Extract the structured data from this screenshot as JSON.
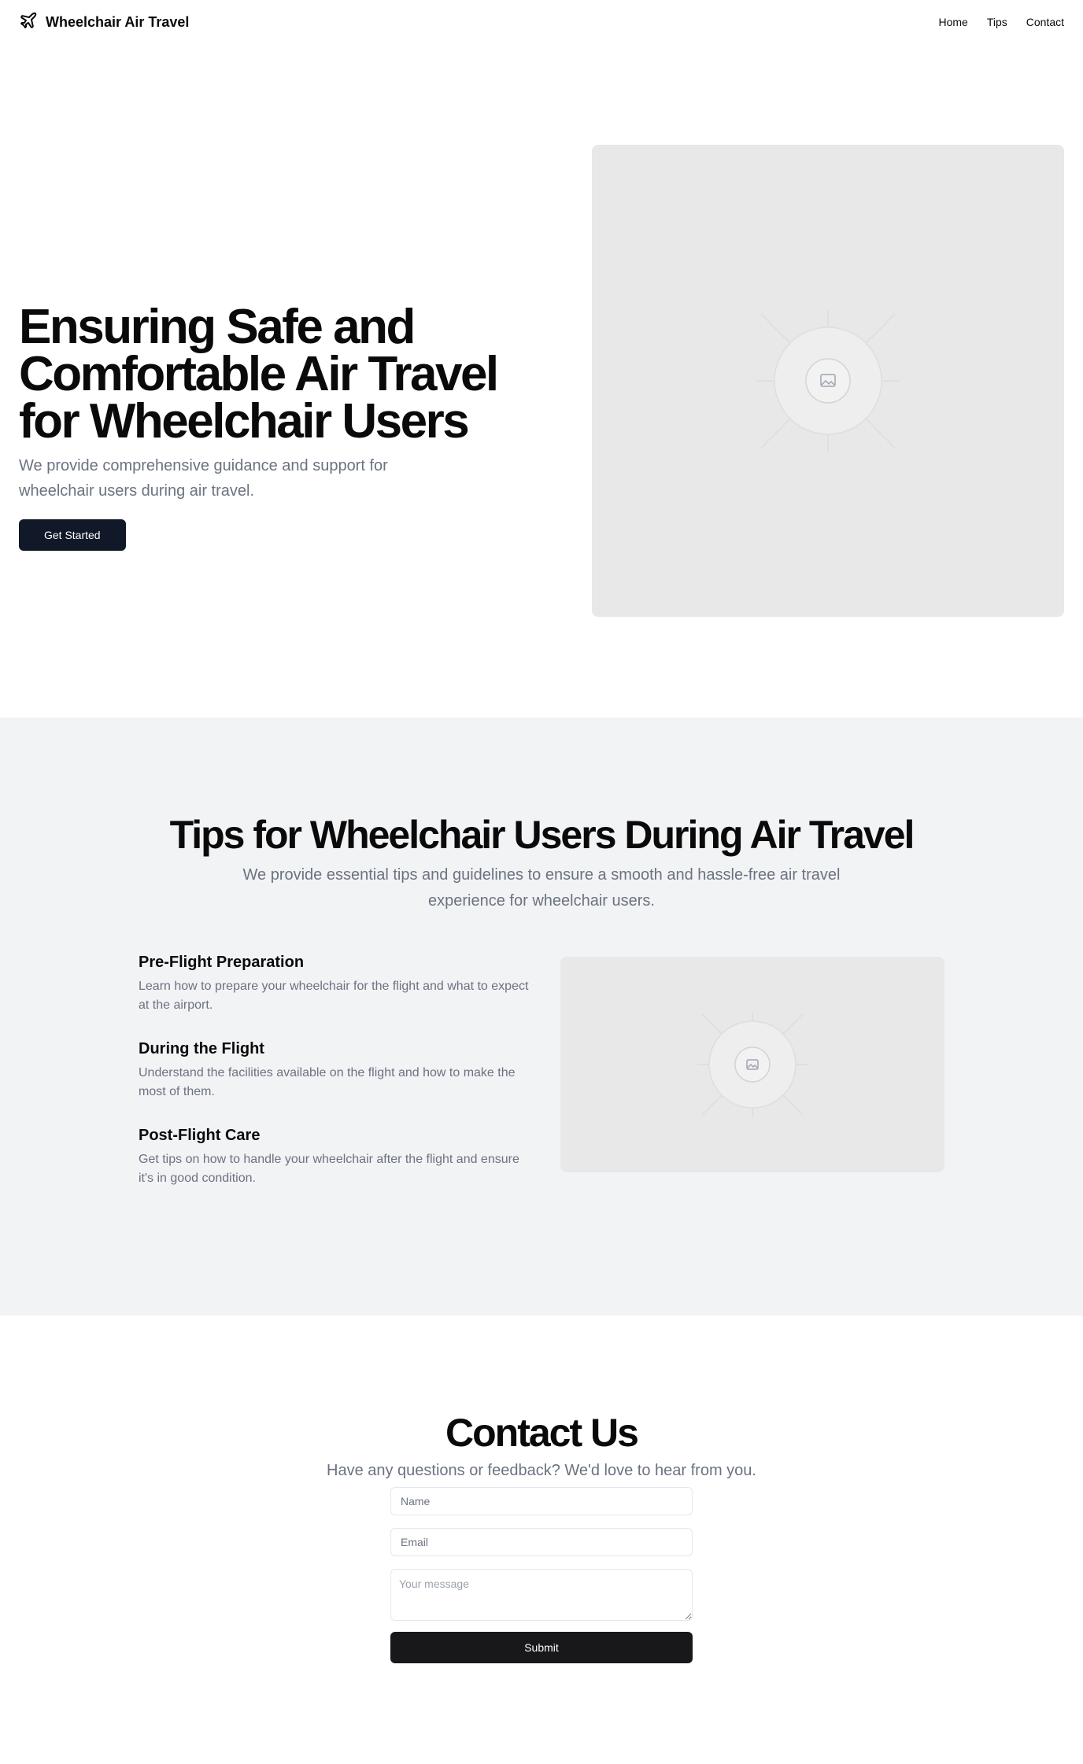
{
  "header": {
    "brand": "Wheelchair Air Travel",
    "nav": [
      "Home",
      "Tips",
      "Contact"
    ]
  },
  "hero": {
    "title": "Ensuring Safe and Comfortable Air Travel for Wheelchair Users",
    "subtitle": "We provide comprehensive guidance and support for wheelchair users during air travel.",
    "cta": "Get Started"
  },
  "tips": {
    "title": "Tips for Wheelchair Users During Air Travel",
    "subtitle": "We provide essential tips and guidelines to ensure a smooth and hassle-free air travel experience for wheelchair users.",
    "items": [
      {
        "title": "Pre-Flight Preparation",
        "text": "Learn how to prepare your wheelchair for the flight and what to expect at the airport."
      },
      {
        "title": "During the Flight",
        "text": "Understand the facilities available on the flight and how to make the most of them."
      },
      {
        "title": "Post-Flight Care",
        "text": "Get tips on how to handle your wheelchair after the flight and ensure it's in good condition."
      }
    ]
  },
  "contact": {
    "title": "Contact Us",
    "subtitle": "Have any questions or feedback? We'd love to hear from you.",
    "name_placeholder": "Name",
    "email_placeholder": "Email",
    "message_placeholder": "Your message",
    "submit": "Submit"
  },
  "colors": {
    "primary_button": "#111827",
    "submit_button": "#18181b",
    "tips_background": "#f2f3f5",
    "muted_text": "#6b7280"
  }
}
